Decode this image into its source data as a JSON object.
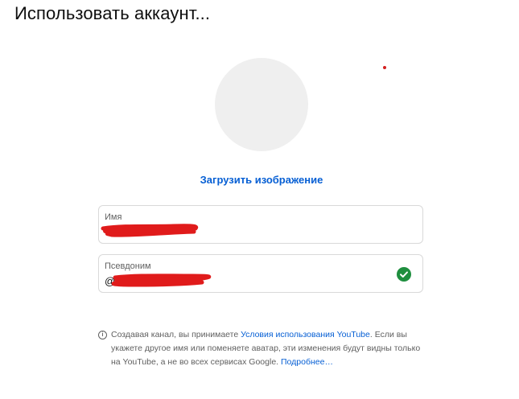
{
  "dialog": {
    "title": "Использовать аккаунт..."
  },
  "avatar": {
    "upload_label": "Загрузить изображение"
  },
  "name_field": {
    "label": "Имя",
    "value": ""
  },
  "handle_field": {
    "label": "Псевдоним",
    "prefix": "@",
    "value": "",
    "status_icon": "check-circle-icon"
  },
  "notice": {
    "icon": "info-icon",
    "text_before": "Создавая канал, вы принимаете ",
    "terms_link": "Условия использования YouTube",
    "text_after": ". Если вы укажете другое имя или поменяете аватар, эти изменения будут видны только на YouTube, а не во всех сервисах Google. ",
    "more_link": "Подробнее…"
  },
  "colors": {
    "accent": "#065fd4",
    "success": "#1e8e3e",
    "redaction": "#e01b1b"
  }
}
